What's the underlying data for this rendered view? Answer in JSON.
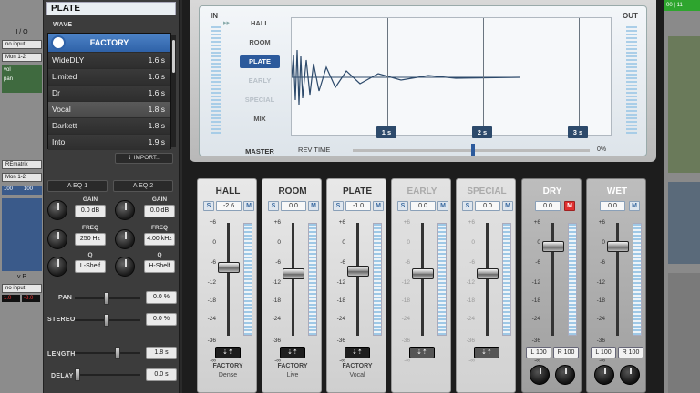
{
  "daw_left": {
    "io_label": "I / O",
    "input": "no input",
    "output": "Mon 1-2",
    "vol_label": "vol",
    "pan_label": "pan",
    "insert_name": "REmatrix",
    "output2": "Mon 1-2",
    "val1": "100",
    "val2": "100",
    "vp_label": "v  P",
    "input2": "no input",
    "num1": "1.0",
    "num2": "-8.0"
  },
  "left_panel": {
    "preset_name": "PLATE",
    "wave_label": "WAVE",
    "list_header": "FACTORY",
    "presets": [
      {
        "name": "WideDLY",
        "time": "1.6 s"
      },
      {
        "name": "Limited",
        "time": "1.6 s"
      },
      {
        "name": "Dr",
        "time": "1.6 s"
      },
      {
        "name": "Vocal",
        "time": "1.8 s"
      },
      {
        "name": "Darkett",
        "time": "1.8 s"
      },
      {
        "name": "Into",
        "time": "1.9 s"
      }
    ],
    "import_label": "IMPORT...",
    "eq1": {
      "label": "EQ 1",
      "gain_label": "GAIN",
      "gain": "0.0 dB",
      "freq_label": "FREQ",
      "freq": "250 Hz",
      "q_label": "Q",
      "q": "L-Shelf"
    },
    "eq2": {
      "label": "EQ 2",
      "gain_label": "GAIN",
      "gain": "0.0 dB",
      "freq_label": "FREQ",
      "freq": "4.00 kHz",
      "q_label": "Q",
      "q": "H-Shelf"
    },
    "pan_label": "PAN",
    "pan_value": "0.0 %",
    "stereo_label": "STEREO",
    "stereo_value": "0.0 %",
    "length_label": "LENGTH",
    "length_value": "1.8 s",
    "delay_label": "DELAY",
    "delay_value": "0.0 s"
  },
  "display": {
    "in_label": "IN",
    "out_label": "OUT",
    "modes": [
      "HALL",
      "ROOM",
      "PLATE",
      "EARLY",
      "SPECIAL",
      "MIX"
    ],
    "active_mode": "PLATE",
    "master_label": "MASTER",
    "rev_time_label": "REV TIME",
    "time_markers": [
      "1 s",
      "2 s",
      "3 s"
    ],
    "percent": "0%"
  },
  "strips": [
    {
      "name": "HALL",
      "value": "-2.6",
      "preset_group": "FACTORY",
      "preset": "Dense",
      "dim": false,
      "level": 0.65
    },
    {
      "name": "ROOM",
      "value": "0.0",
      "preset_group": "FACTORY",
      "preset": "Live",
      "dim": false,
      "level": 0.6
    },
    {
      "name": "PLATE",
      "value": "-1.0",
      "preset_group": "FACTORY",
      "preset": "Vocal",
      "dim": false,
      "level": 0.62
    },
    {
      "name": "EARLY",
      "value": "0.0",
      "preset_group": "",
      "preset": "",
      "dim": true,
      "level": 0.6
    },
    {
      "name": "SPECIAL",
      "value": "0.0",
      "preset_group": "",
      "preset": "",
      "dim": true,
      "level": 0.6
    }
  ],
  "drywet": [
    {
      "name": "DRY",
      "value": "0.0",
      "left": "L 100",
      "right": "R 100"
    },
    {
      "name": "WET",
      "value": "0.0",
      "left": "L 100",
      "right": "R 100"
    }
  ],
  "scale_labels": [
    "+6",
    "0",
    "-6",
    "-12",
    "-18",
    "-24",
    "-36",
    "-∞"
  ],
  "s_label": "S",
  "m_label": "M",
  "daw_right": {
    "top_label": "00 | 11"
  }
}
